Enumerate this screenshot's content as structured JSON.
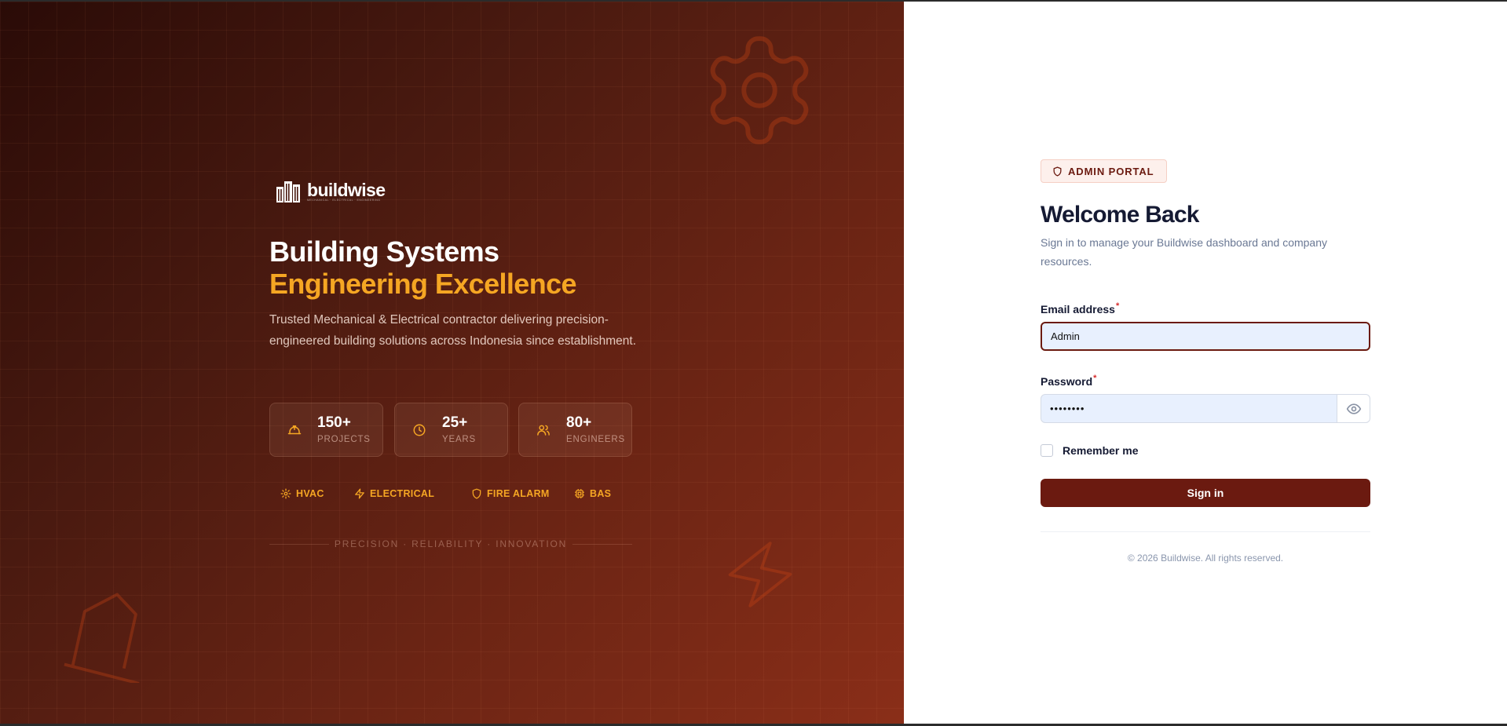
{
  "brand": {
    "logo_text": "buildwise",
    "logo_tagline": "MECHANICAL · ELECTRICAL · ENGINEERING"
  },
  "hero": {
    "headline_line1": "Building Systems",
    "headline_line2": "Engineering Excellence",
    "description": "Trusted Mechanical & Electrical contractor delivering precision-engineered building solutions across Indonesia since establishment.",
    "stats": [
      {
        "value": "150+",
        "label": "PROJECTS",
        "icon": "hard-hat-icon"
      },
      {
        "value": "25+",
        "label": "YEARS",
        "icon": "clock-icon"
      },
      {
        "value": "80+",
        "label": "ENGINEERS",
        "icon": "users-icon"
      }
    ],
    "tags": [
      {
        "label": "HVAC",
        "icon": "gear-icon"
      },
      {
        "label": "ELECTRICAL",
        "icon": "lightning-icon"
      },
      {
        "label": "FIRE ALARM",
        "icon": "shield-icon"
      },
      {
        "label": "BAS",
        "icon": "cpu-icon"
      }
    ],
    "tagline": "PRECISION · RELIABILITY · INNOVATION"
  },
  "login": {
    "badge": "ADMIN PORTAL",
    "title": "Welcome Back",
    "subtitle": "Sign in to manage your Buildwise dashboard and company resources.",
    "email_label": "Email address",
    "email_value": "Admin",
    "password_label": "Password",
    "password_value": "password",
    "required_mark": "*",
    "remember_label": "Remember me",
    "submit_label": "Sign in",
    "copyright": "© 2026 Buildwise. All rights reserved."
  },
  "colors": {
    "accent": "#6b1a10",
    "highlight": "#f5a623",
    "title": "#151a33"
  }
}
